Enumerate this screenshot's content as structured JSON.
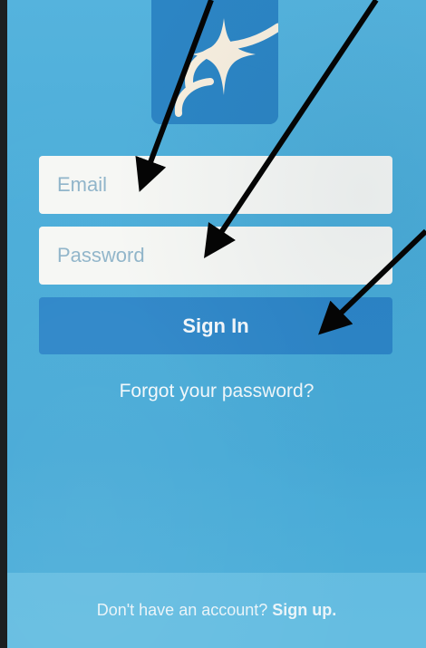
{
  "login": {
    "email_placeholder": "Email",
    "password_placeholder": "Password",
    "signin_label": "Sign In",
    "forgot_label": "Forgot your password?"
  },
  "footer": {
    "prompt": "Don't have an account?",
    "signup_label": "Sign up."
  },
  "icons": {
    "logo": "star-wave-logo-icon",
    "annotation": "arrow-annotation"
  },
  "colors": {
    "screen_background": "#4aacd8",
    "logo_background": "#2c85c4",
    "button_background": "#2d86c8",
    "field_background": "#f6f7f4",
    "placeholder_text": "#8fb4c9"
  }
}
